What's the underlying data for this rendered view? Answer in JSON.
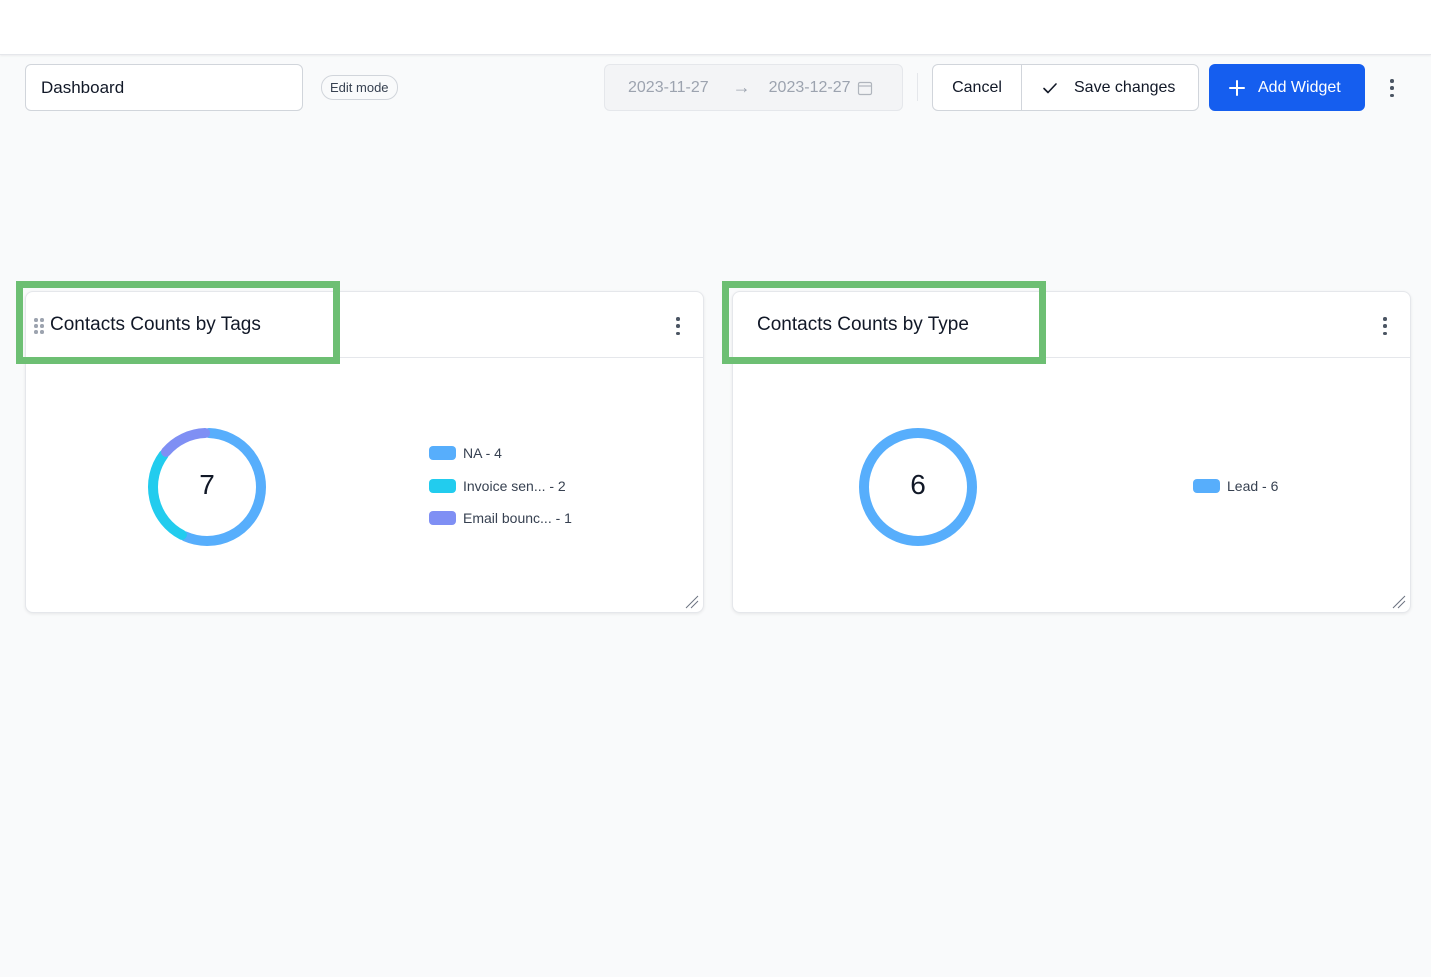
{
  "toolbar": {
    "dashboard_name": "Dashboard",
    "mode_badge": "Edit mode",
    "date_start": "2023-11-27",
    "date_end": "2023-12-27",
    "cancel_label": "Cancel",
    "save_label": "Save changes",
    "add_widget_label": "Add Widget",
    "accent_color": "#155eef"
  },
  "widgets": [
    {
      "title": "Contacts Counts by Tags",
      "total": "7",
      "legend": [
        {
          "label": "NA - 4",
          "value": 4,
          "color": "#57aefc"
        },
        {
          "label": "Invoice sen... - 2",
          "value": 2,
          "color": "#22ccee"
        },
        {
          "label": "Email bounc... - 1",
          "value": 1,
          "color": "#7f8ff4"
        }
      ]
    },
    {
      "title": "Contacts Counts by Type",
      "total": "6",
      "legend": [
        {
          "label": "Lead - 6",
          "value": 6,
          "color": "#57aefc"
        }
      ]
    }
  ]
}
